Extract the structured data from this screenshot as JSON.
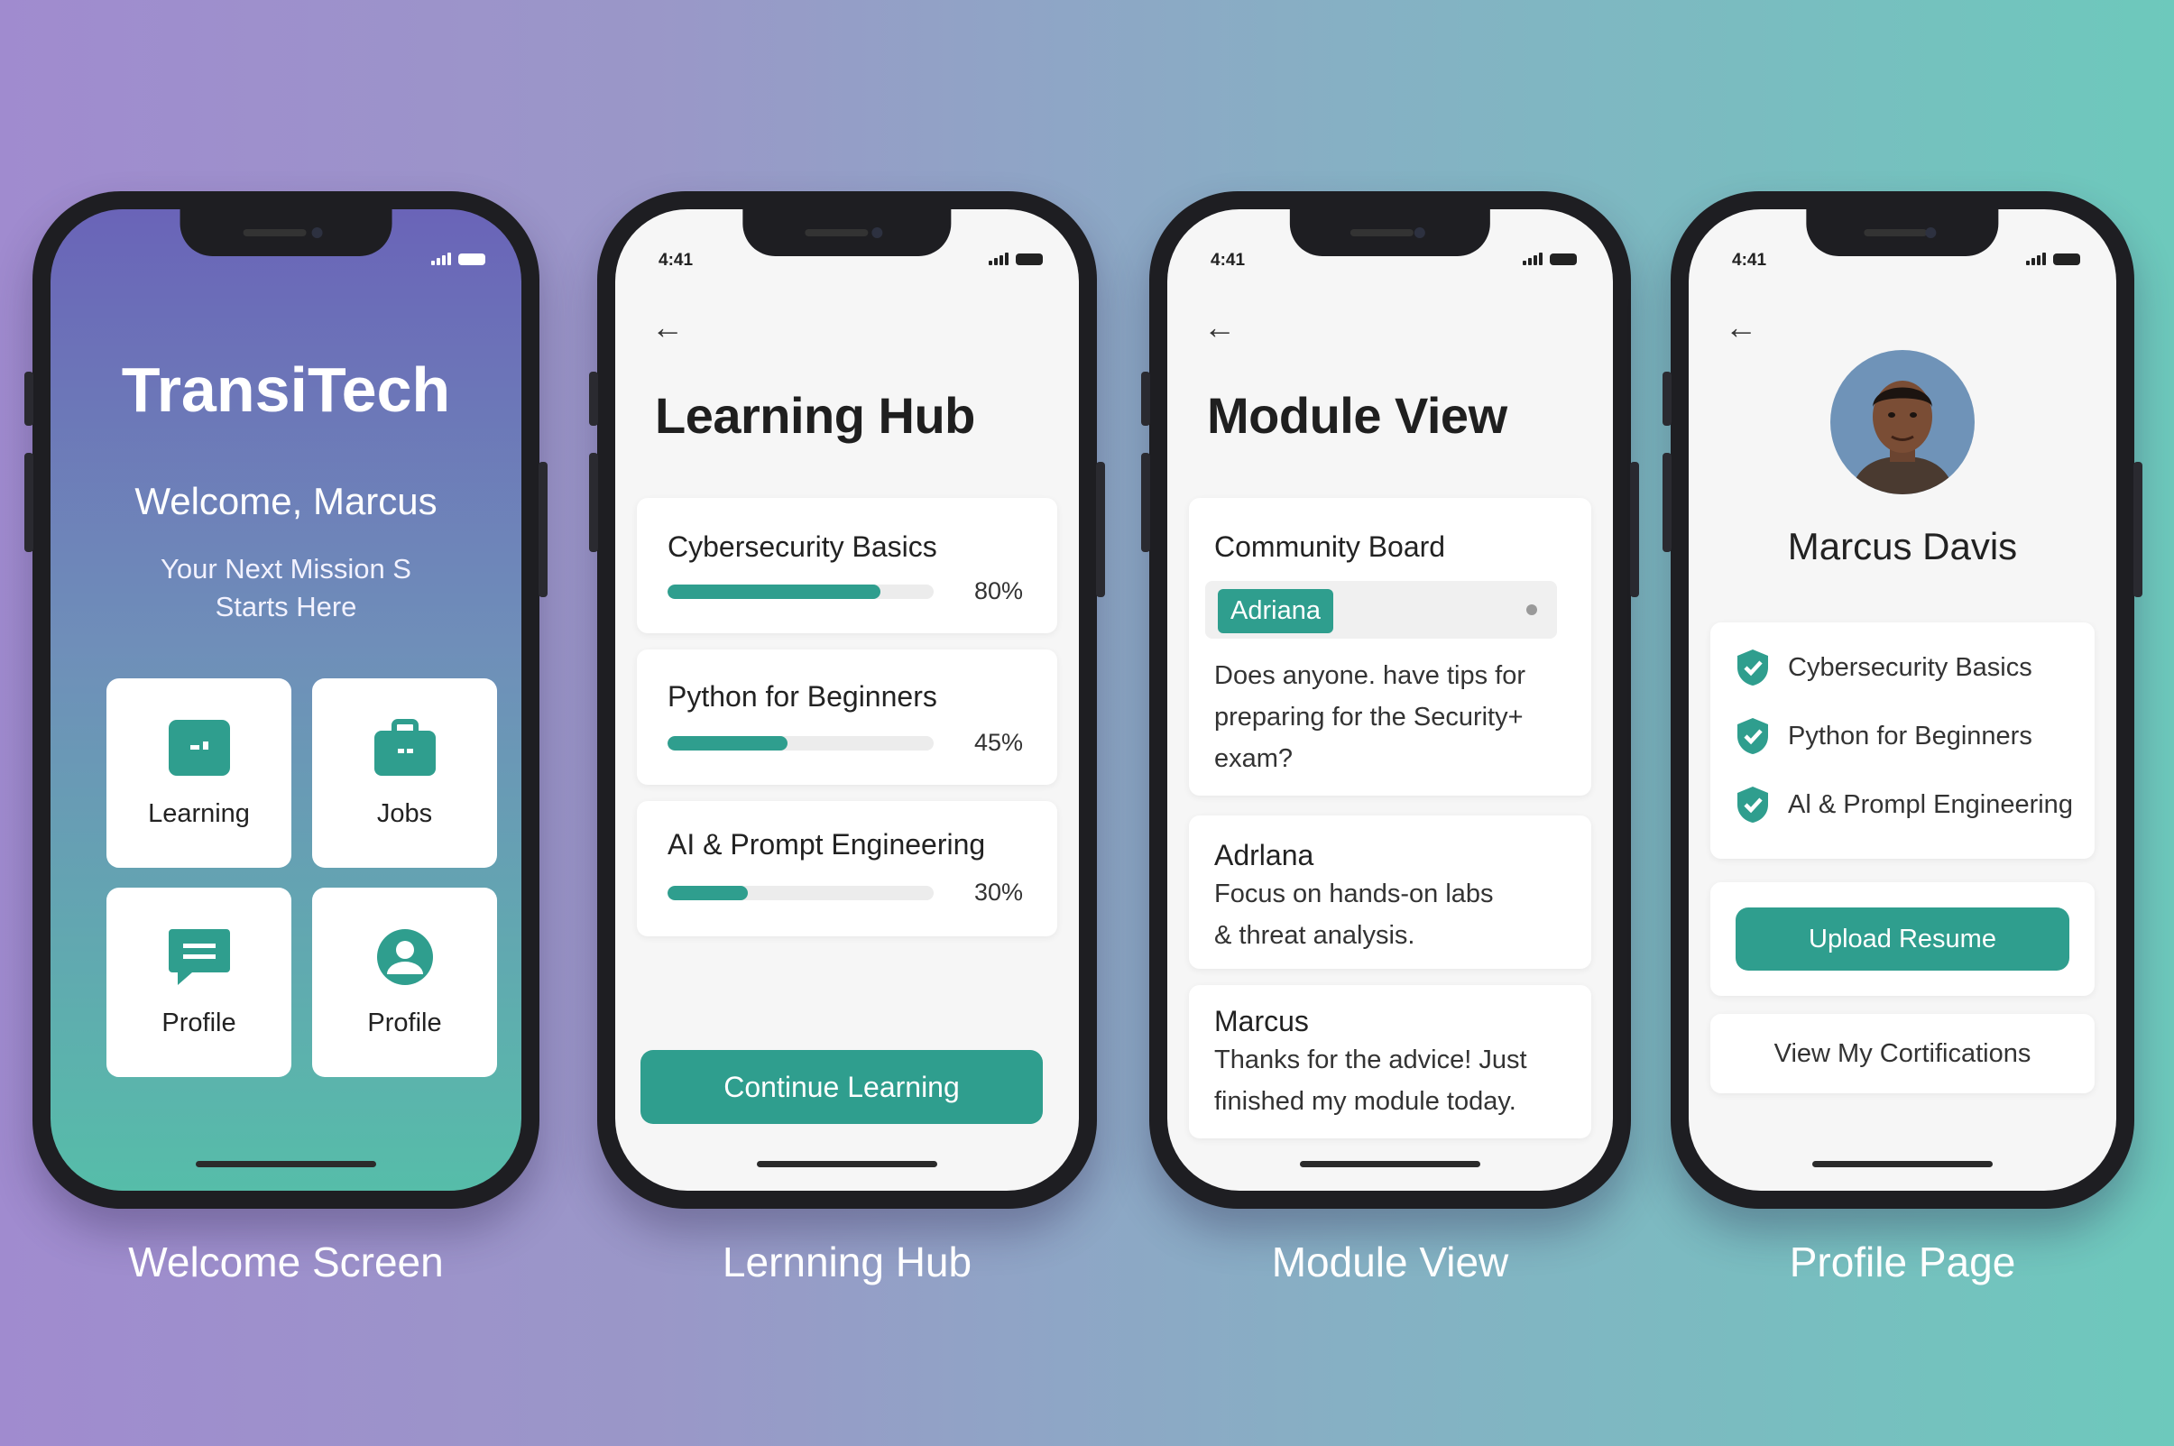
{
  "status": {
    "time": "4:41"
  },
  "captions": {
    "welcome": "Welcome Screen",
    "learning": "Lernning Hub",
    "module": "Module View",
    "profile": "Profile Page"
  },
  "welcome": {
    "app_title": "TransiTech",
    "greeting": "Welcome, Marcus",
    "subtitle": "Your Next Mission S Starts Here",
    "tiles": [
      {
        "label": "Learning",
        "icon": "monitor-icon"
      },
      {
        "label": "Jobs",
        "icon": "briefcase-icon"
      },
      {
        "label": "Profile",
        "icon": "chat-icon"
      },
      {
        "label": "Profile",
        "icon": "user-icon"
      }
    ]
  },
  "learning_hub": {
    "title": "Learning Hub",
    "courses": [
      {
        "name": "Cybersecurity Basics",
        "progress": 80,
        "progress_label": "80%"
      },
      {
        "name": "Python for Beginners",
        "progress": 45,
        "progress_label": "45%"
      },
      {
        "name": "AI & Prompt Engineering",
        "progress": 30,
        "progress_label": "30%"
      }
    ],
    "continue_label": "Continue Learning"
  },
  "module_view": {
    "title": "Module View",
    "board_title": "Community Board",
    "chip_label": "Adriana",
    "question": "Does anyone. have tips for preparing for the Security+ exam?",
    "replies": [
      {
        "name": "Adrlana",
        "text": "Focus on  hands-on labs & threat analysis."
      },
      {
        "name": "Marcus",
        "text": "Thanks for the advice!  Just finished my module today."
      }
    ]
  },
  "profile": {
    "name": "Marcus Davis",
    "certifications": [
      "Cybersecurity  Basics",
      "Python for Beginners",
      "Al & Prompl Engineering"
    ],
    "upload_label": "Upload Resume",
    "view_label": "View My Cortifications"
  },
  "colors": {
    "accent": "#2f9e8e",
    "welcome_gradient_top": "#6a64b8",
    "welcome_gradient_bottom": "#56bda9"
  }
}
